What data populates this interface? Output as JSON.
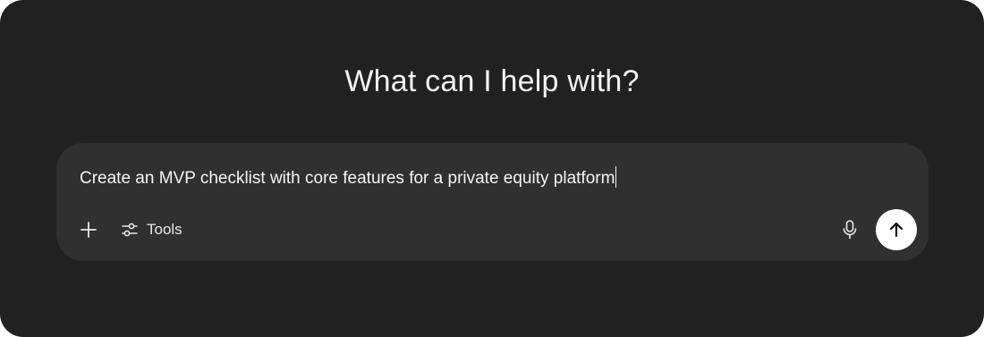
{
  "headline": "What can I help with?",
  "composer": {
    "input_value": "Create an MVP checklist with core features for a private equity platform",
    "add_icon": "plus-icon",
    "tools": {
      "label": "Tools",
      "icon": "sliders-icon"
    },
    "mic_icon": "microphone-icon",
    "send_icon": "arrow-up-icon"
  },
  "colors": {
    "background": "#212121",
    "composer": "#303030",
    "text": "#ececec",
    "send_button": "#ffffff"
  }
}
